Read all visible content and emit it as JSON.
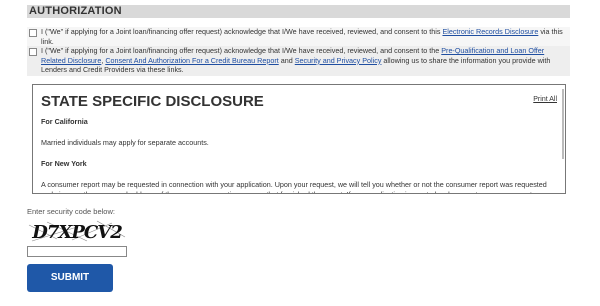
{
  "section": {
    "title": "AUTHORIZATION"
  },
  "consents": [
    {
      "text_before": "I (\"We\" if applying for a Joint loan/financing offer request) acknowledge that I/We have received, reviewed, and consent to this ",
      "link1": "Electronic Records Disclosure",
      "text_after": " via this link."
    },
    {
      "text_before": "I (\"We\" if applying for a Joint loan/financing offer request) acknowledge that I/We have received, reviewed, and consent to the ",
      "link1": "Pre-Qualification and Loan Offer Related Disclosure",
      "sep1": ", ",
      "link2": "Consent And Authorization For a Credit Bureau Report",
      "sep2": " and ",
      "link3": "Security and Privacy Policy",
      "text_after": " allowing us to share the information you provide with Lenders and Credit Providers via these links."
    }
  ],
  "disclosure": {
    "title": "STATE SPECIFIC DISCLOSURE",
    "print_all": "Print All",
    "california_heading": "For California",
    "california_text": "Married individuals may apply for separate accounts.",
    "newyork_heading": "For New York",
    "newyork_text": "A consumer report may be requested in connection with your application. Upon your request, we will tell you whether or not the consumer report was requested and give you the name and address of the consumer reporting agency that furnished the report. If your application is granted, subsequent consumer reports"
  },
  "security": {
    "label": "Enter security code below:",
    "captcha_text": "D7XPCV2",
    "input_value": ""
  },
  "submit_label": "SUBMIT"
}
